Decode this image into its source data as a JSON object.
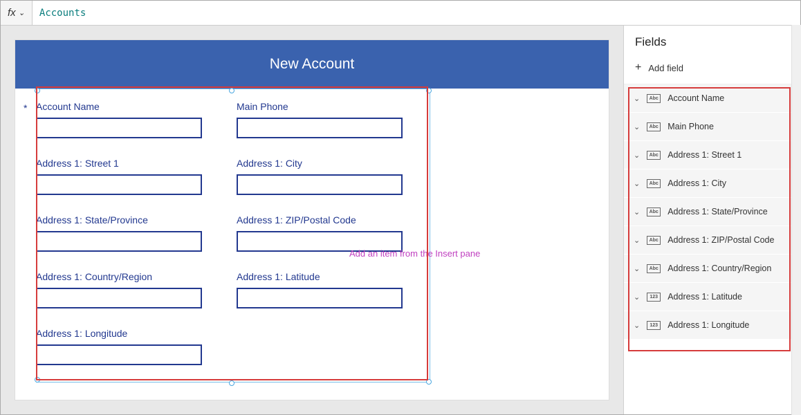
{
  "formula_bar": {
    "fx": "fx",
    "value": "Accounts"
  },
  "form": {
    "title": "New Account",
    "hint": "Add an item from the Insert pane",
    "fields": [
      {
        "label": "Account Name",
        "required": true
      },
      {
        "label": "Main Phone",
        "required": false
      },
      {
        "label": "Address 1: Street 1",
        "required": false
      },
      {
        "label": "Address 1: City",
        "required": false
      },
      {
        "label": "Address 1: State/Province",
        "required": false
      },
      {
        "label": "Address 1: ZIP/Postal Code",
        "required": false
      },
      {
        "label": "Address 1: Country/Region",
        "required": false
      },
      {
        "label": "Address 1: Latitude",
        "required": false
      },
      {
        "label": "Address 1: Longitude",
        "required": false
      }
    ]
  },
  "panel": {
    "title": "Fields",
    "add_label": "Add field",
    "items": [
      {
        "label": "Account Name",
        "type": "Abc"
      },
      {
        "label": "Main Phone",
        "type": "Abc"
      },
      {
        "label": "Address 1: Street 1",
        "type": "Abc"
      },
      {
        "label": "Address 1: City",
        "type": "Abc"
      },
      {
        "label": "Address 1: State/Province",
        "type": "Abc"
      },
      {
        "label": "Address 1: ZIP/Postal Code",
        "type": "Abc"
      },
      {
        "label": "Address 1: Country/Region",
        "type": "Abc"
      },
      {
        "label": "Address 1: Latitude",
        "type": "123"
      },
      {
        "label": "Address 1: Longitude",
        "type": "123"
      }
    ]
  }
}
